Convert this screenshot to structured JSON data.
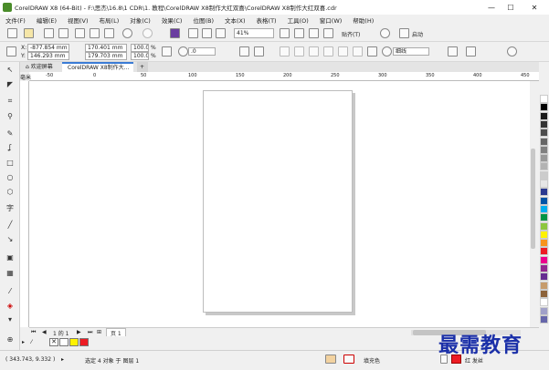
{
  "title_bar": {
    "title": "CorelDRAW X8 (64-Bit) - F:\\思杰\\16.8\\1 CDR\\1. 教程\\CorelDRAW X8制作大红双喜\\CorelDRAW X8制作大红双喜.cdr",
    "minimize": "—",
    "maximize": "☐",
    "close": "✕"
  },
  "menu": [
    "文件(F)",
    "编辑(E)",
    "视图(V)",
    "布局(L)",
    "对象(C)",
    "效果(C)",
    "位图(B)",
    "文本(X)",
    "表格(T)",
    "工具(O)",
    "窗口(W)",
    "帮助(H)"
  ],
  "standard_toolbar": {
    "zoom": "41%",
    "snap_label": "贴齐(T)",
    "launch_label": "启动"
  },
  "property_bar": {
    "x": "-877.854 mm",
    "y": "146.293 mm",
    "x_label": "X:",
    "y_label": "Y:",
    "width": "170.401 mm",
    "height": "179.703 mm",
    "scale_x": "100.0",
    "scale_y": "100.0",
    "percent": "%",
    "rotation": ".0",
    "outline": "细线"
  },
  "tabs": [
    {
      "label": "欢迎屏幕"
    },
    {
      "label": "CorelDRAW X8制作大..."
    }
  ],
  "tab_add": "+",
  "ruler_ticks": [
    "-50",
    "0",
    "50",
    "100",
    "150",
    "200",
    "250",
    "300",
    "350",
    "400",
    "450"
  ],
  "ruler_unit": "毫米",
  "page_nav": {
    "page_of": "1 的 1",
    "page_tab": "页 1"
  },
  "status": {
    "coords": "( 343.743, 9.332 )",
    "selection": "选定 4 对象 于 图层 1",
    "fill_label": "填充色",
    "outline_label": "红 发丝"
  },
  "watermark": "最需教育",
  "palette_colors": [
    "#ffffff",
    "#000000",
    "#1a1a1a",
    "#333333",
    "#4d4d4d",
    "#666666",
    "#808080",
    "#999999",
    "#b3b3b3",
    "#cccccc",
    "#e6e6e6",
    "#2b3990",
    "#0054a6",
    "#00aeef",
    "#009444",
    "#8dc63f",
    "#fff200",
    "#f7941d",
    "#ed1c24",
    "#ec008c",
    "#92278f",
    "#662d91",
    "#c69c6d",
    "#8c6239",
    "#ffffff",
    "#a0a0c8",
    "#6666aa"
  ],
  "doc_palette": [
    "#ffffff",
    "#fff200",
    "#ed1c24"
  ]
}
